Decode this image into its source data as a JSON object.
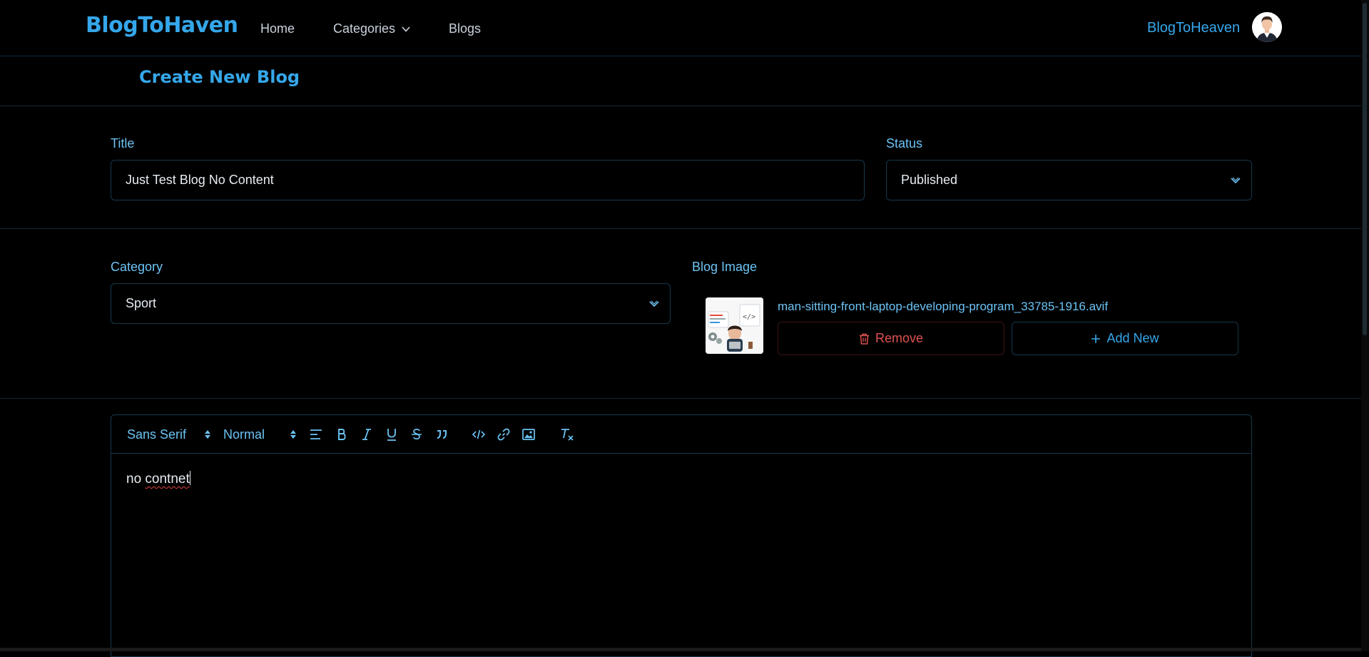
{
  "navbar": {
    "brand": "BlogToHaven",
    "links": [
      "Home",
      "Categories",
      "Blogs"
    ],
    "user_name": "BlogToHeaven"
  },
  "page": {
    "title": "Create New Blog"
  },
  "form": {
    "title_label": "Title",
    "title_value": "Just Test Blog No Content",
    "status_label": "Status",
    "status_value": "Published",
    "category_label": "Category",
    "category_value": "Sport",
    "image_label": "Blog Image",
    "image_filename": "man-sitting-front-laptop-developing-program_33785-1916.avif",
    "remove_label": "Remove",
    "add_new_label": "Add New"
  },
  "editor": {
    "font_select": "Sans Serif",
    "size_select": "Normal",
    "content_word1": "no",
    "content_word2": "contnet"
  },
  "colors": {
    "accent": "#35a7ea",
    "label": "#6cc3f4",
    "danger": "#e05252",
    "background": "#000000",
    "border": "#16384d"
  },
  "icons": [
    "chevron-down-icon",
    "trash-icon",
    "plus-icon",
    "align-icon",
    "bold-icon",
    "italic-icon",
    "underline-icon",
    "strike-icon",
    "quote-icon",
    "code-icon",
    "link-icon",
    "image-icon",
    "clear-format-icon"
  ]
}
